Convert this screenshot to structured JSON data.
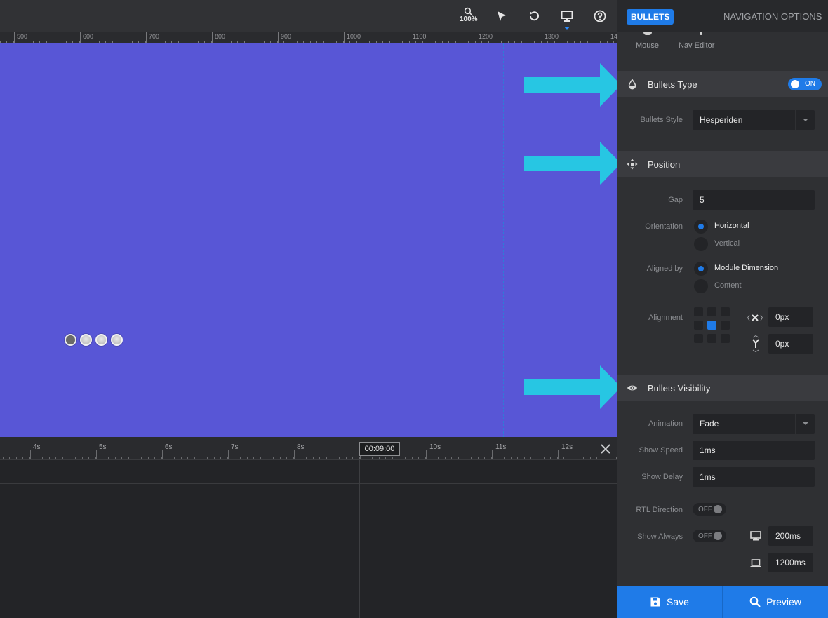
{
  "toolbar": {
    "zoom_label": "100%",
    "icons": [
      "search-icon",
      "cursor-icon",
      "undo-icon",
      "desktop-icon",
      "help-icon"
    ]
  },
  "ruler": {
    "labels": [
      "500",
      "600",
      "700",
      "800",
      "900",
      "1000",
      "1100",
      "1200",
      "1300",
      "14"
    ]
  },
  "panel": {
    "tabs": {
      "bullets": "BULLETS",
      "navigation": "NAVIGATION OPTIONS"
    },
    "modes": {
      "mouse": "Mouse",
      "nav_editor": "Nav Editor"
    },
    "bullets_type": {
      "title": "Bullets Type",
      "toggle": "ON",
      "style_label": "Bullets Style",
      "style_value": "Hesperiden"
    },
    "position": {
      "title": "Position",
      "gap_label": "Gap",
      "gap_value": "5",
      "orientation_label": "Orientation",
      "orientation_options": [
        "Horizontal",
        "Vertical"
      ],
      "aligned_label": "Aligned by",
      "aligned_options": [
        "Module Dimension",
        "Content"
      ],
      "alignment_label": "Alignment",
      "x_value": "0px",
      "y_value": "0px"
    },
    "visibility": {
      "title": "Bullets Visibility",
      "animation_label": "Animation",
      "animation_value": "Fade",
      "show_speed_label": "Show Speed",
      "show_speed_value": "1ms",
      "show_delay_label": "Show Delay",
      "show_delay_value": "1ms",
      "rtl_label": "RTL Direction",
      "rtl_toggle": "OFF",
      "show_always_label": "Show Always",
      "show_always_toggle": "OFF",
      "desktop_value": "200ms",
      "laptop_value": "1200ms"
    },
    "footer": {
      "save": "Save",
      "preview": "Preview"
    }
  },
  "timeline": {
    "labels": [
      "4s",
      "5s",
      "6s",
      "7s",
      "8s",
      "10s",
      "11s",
      "12s"
    ],
    "current_time": "00:09:00"
  },
  "colors": {
    "canvas_bg": "#5856d6",
    "accent": "#1f7be8",
    "arrow": "#27c6e3"
  }
}
